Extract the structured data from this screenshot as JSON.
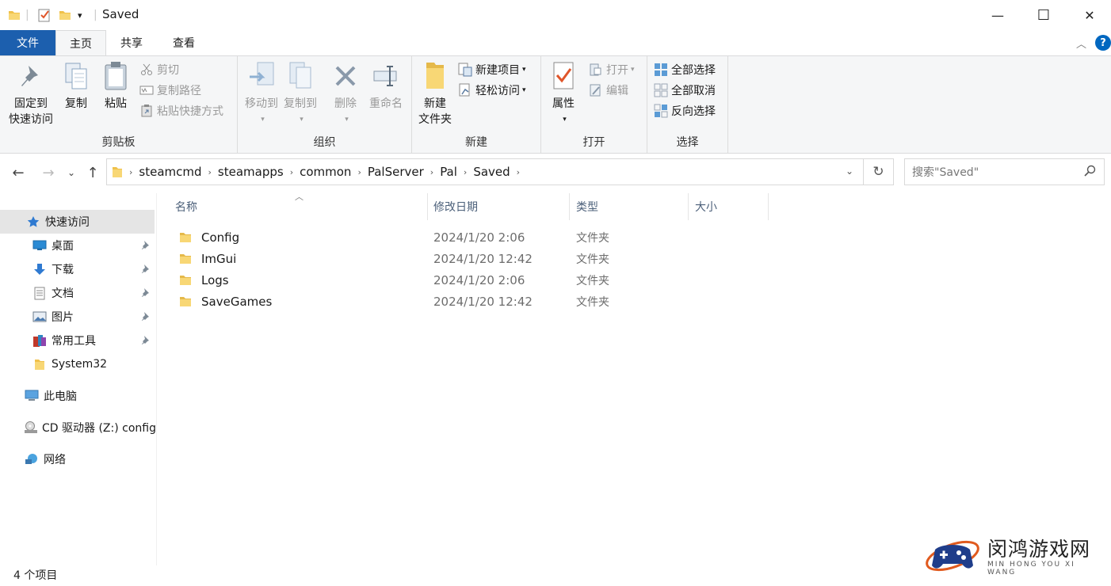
{
  "window": {
    "title": "Saved",
    "minimize": "—",
    "maximize": "☐",
    "close": "✕"
  },
  "tabs": {
    "file": "文件",
    "home": "主页",
    "share": "共享",
    "view": "查看"
  },
  "ribbon": {
    "clipboard": {
      "label": "剪贴板",
      "pin_line1": "固定到",
      "pin_line2": "快速访问",
      "copy": "复制",
      "paste": "粘贴",
      "cut": "剪切",
      "copy_path": "复制路径",
      "paste_shortcut": "粘贴快捷方式"
    },
    "organize": {
      "label": "组织",
      "move_to": "移动到",
      "copy_to": "复制到",
      "delete": "删除",
      "rename": "重命名"
    },
    "new": {
      "label": "新建",
      "new_folder_line1": "新建",
      "new_folder_line2": "文件夹",
      "new_item": "新建项目",
      "easy_access": "轻松访问"
    },
    "open": {
      "label": "打开",
      "properties": "属性",
      "open": "打开",
      "edit": "编辑"
    },
    "select": {
      "label": "选择",
      "select_all": "全部选择",
      "select_none": "全部取消",
      "invert": "反向选择"
    }
  },
  "address": {
    "crumbs": [
      "steamcmd",
      "steamapps",
      "common",
      "PalServer",
      "Pal",
      "Saved"
    ],
    "search_placeholder": "搜索\"Saved\""
  },
  "nav": {
    "quick_access": "快速访问",
    "desktop": "桌面",
    "downloads": "下载",
    "documents": "文档",
    "pictures": "图片",
    "tools": "常用工具",
    "system32": "System32",
    "this_pc": "此电脑",
    "cd_drive": "CD 驱动器 (Z:) config",
    "network": "网络"
  },
  "columns": {
    "name": "名称",
    "modified": "修改日期",
    "type": "类型",
    "size": "大小"
  },
  "files": [
    {
      "name": "Config",
      "modified": "2024/1/20 2:06",
      "type": "文件夹"
    },
    {
      "name": "ImGui",
      "modified": "2024/1/20 12:42",
      "type": "文件夹"
    },
    {
      "name": "Logs",
      "modified": "2024/1/20 2:06",
      "type": "文件夹"
    },
    {
      "name": "SaveGames",
      "modified": "2024/1/20 12:42",
      "type": "文件夹"
    }
  ],
  "status": {
    "count": "4 个项目"
  },
  "watermark": {
    "title": "闵鸿游戏网",
    "subtitle": "MIN HONG YOU XI WANG"
  },
  "colors": {
    "file_tab": "#1c5fae",
    "folder": "#f0c14b",
    "accent": "#0067c0"
  }
}
